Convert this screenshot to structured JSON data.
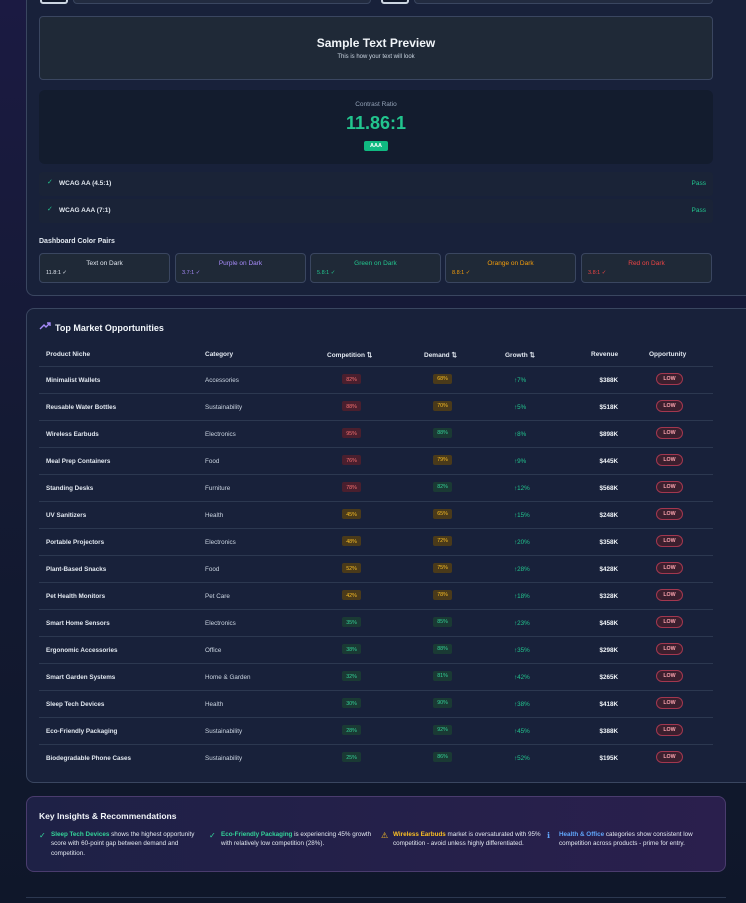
{
  "preview": {
    "title": "Sample Text Preview",
    "subtitle": "This is how your text will look"
  },
  "contrast": {
    "label": "Contrast Ratio",
    "value": "11.86:1",
    "badge": "AAA"
  },
  "wcag": [
    {
      "name": "WCAG AA (4.5:1)",
      "status": "Pass"
    },
    {
      "name": "WCAG AAA (7:1)",
      "status": "Pass"
    }
  ],
  "pairs_title": "Dashboard Color Pairs",
  "pairs": [
    {
      "name": "Text on Dark",
      "ratio": "11.8:1 ✓",
      "color": "#e2e8f0"
    },
    {
      "name": "Purple on Dark",
      "ratio": "3.7:1 ✓",
      "color": "#a78bfa"
    },
    {
      "name": "Green on Dark",
      "ratio": "5.8:1 ✓",
      "color": "#22c58e"
    },
    {
      "name": "Orange on Dark",
      "ratio": "8.8:1 ✓",
      "color": "#f59e0b"
    },
    {
      "name": "Red on Dark",
      "ratio": "3.8:1 ✓",
      "color": "#ef4444"
    }
  ],
  "table": {
    "title": "Top Market Opportunities",
    "headers": {
      "niche": "Product Niche",
      "category": "Category",
      "competition": "Competition ⇅",
      "demand": "Demand ⇅",
      "growth": "Growth ⇅",
      "revenue": "Revenue",
      "opportunity": "Opportunity"
    },
    "rows": [
      {
        "niche": "Minimalist Wallets",
        "category": "Accessories",
        "competition": "82%",
        "demand": "68%",
        "growth": "↑7%",
        "revenue": "$388K",
        "opportunity": "LOW"
      },
      {
        "niche": "Reusable Water Bottles",
        "category": "Sustainability",
        "competition": "88%",
        "demand": "70%",
        "growth": "↑5%",
        "revenue": "$518K",
        "opportunity": "LOW"
      },
      {
        "niche": "Wireless Earbuds",
        "category": "Electronics",
        "competition": "95%",
        "demand": "88%",
        "growth": "↑8%",
        "revenue": "$898K",
        "opportunity": "LOW"
      },
      {
        "niche": "Meal Prep Containers",
        "category": "Food",
        "competition": "76%",
        "demand": "79%",
        "growth": "↑9%",
        "revenue": "$445K",
        "opportunity": "LOW"
      },
      {
        "niche": "Standing Desks",
        "category": "Furniture",
        "competition": "78%",
        "demand": "82%",
        "growth": "↑12%",
        "revenue": "$568K",
        "opportunity": "LOW"
      },
      {
        "niche": "UV Sanitizers",
        "category": "Health",
        "competition": "45%",
        "demand": "65%",
        "growth": "↑15%",
        "revenue": "$248K",
        "opportunity": "LOW"
      },
      {
        "niche": "Portable Projectors",
        "category": "Electronics",
        "competition": "48%",
        "demand": "72%",
        "growth": "↑20%",
        "revenue": "$358K",
        "opportunity": "LOW"
      },
      {
        "niche": "Plant-Based Snacks",
        "category": "Food",
        "competition": "52%",
        "demand": "75%",
        "growth": "↑28%",
        "revenue": "$428K",
        "opportunity": "LOW"
      },
      {
        "niche": "Pet Health Monitors",
        "category": "Pet Care",
        "competition": "42%",
        "demand": "78%",
        "growth": "↑18%",
        "revenue": "$328K",
        "opportunity": "LOW"
      },
      {
        "niche": "Smart Home Sensors",
        "category": "Electronics",
        "competition": "35%",
        "demand": "85%",
        "growth": "↑23%",
        "revenue": "$458K",
        "opportunity": "LOW"
      },
      {
        "niche": "Ergonomic Accessories",
        "category": "Office",
        "competition": "38%",
        "demand": "88%",
        "growth": "↑35%",
        "revenue": "$298K",
        "opportunity": "LOW"
      },
      {
        "niche": "Smart Garden Systems",
        "category": "Home & Garden",
        "competition": "32%",
        "demand": "81%",
        "growth": "↑42%",
        "revenue": "$265K",
        "opportunity": "LOW"
      },
      {
        "niche": "Sleep Tech Devices",
        "category": "Health",
        "competition": "30%",
        "demand": "90%",
        "growth": "↑38%",
        "revenue": "$418K",
        "opportunity": "LOW"
      },
      {
        "niche": "Eco-Friendly Packaging",
        "category": "Sustainability",
        "competition": "28%",
        "demand": "92%",
        "growth": "↑45%",
        "revenue": "$388K",
        "opportunity": "LOW"
      },
      {
        "niche": "Biodegradable Phone Cases",
        "category": "Sustainability",
        "competition": "25%",
        "demand": "86%",
        "growth": "↑52%",
        "revenue": "$195K",
        "opportunity": "LOW"
      }
    ]
  },
  "insights": {
    "title": "Key Insights & Recommendations",
    "items": [
      {
        "icon": "✓",
        "icon_name": "check-icon",
        "highlight": "Sleep Tech Devices",
        "text": " shows the highest opportunity score with 60-point gap between demand and competition.",
        "hl_class": "hl-g",
        "icon_color": "#34d399"
      },
      {
        "icon": "✓",
        "icon_name": "check-icon",
        "highlight": "Eco-Friendly Packaging",
        "text": " is experiencing 45% growth with relatively low competition (28%).",
        "hl_class": "hl-g",
        "icon_color": "#34d399"
      },
      {
        "icon": "⚠",
        "icon_name": "warning-icon",
        "highlight": "Wireless Earbuds",
        "text": " market is oversaturated with 95% competition - avoid unless highly differentiated.",
        "hl_class": "hl-y",
        "icon_color": "#fbbf24"
      },
      {
        "icon": "ℹ",
        "icon_name": "info-icon",
        "highlight": "Health & Office",
        "text": " categories show consistent low competition across products - prime for entry.",
        "hl_class": "hl-b",
        "icon_color": "#60a5fa"
      }
    ]
  }
}
